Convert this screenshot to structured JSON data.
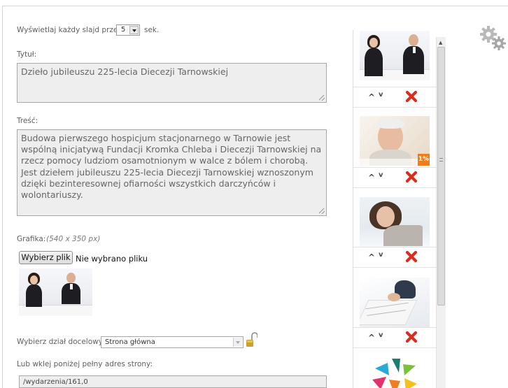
{
  "slide_duration": {
    "label": "Wyświetlaj każdy slajd przez:",
    "value": "5",
    "unit": "sek."
  },
  "title_field": {
    "label": "Tytuł:",
    "value": "Dzieło jubileuszu 225-lecia Diecezji Tarnowskiej"
  },
  "content_field": {
    "label": "Treść:",
    "value": "Budowa pierwszego hospicjum stacjonarnego w Tarnowie jest wspólną inicjatywą Fundacji Kromka Chleba i Diecezji Tarnowskiej na rzecz pomocy ludziom osamotnionym w walce z bólem i chorobą. Jest dziełem jubileuszu 225-lecia Diecezji Tarnowskiej wznoszonym dzięki bezinteresownej ofiarności wszystkich darczyńców i wolontariuszy."
  },
  "graphic": {
    "label": "Grafika:",
    "size_hint": "(540 x 350 px)",
    "choose_button": "Wybierz plik",
    "no_file_text": "Nie wybrano pliku"
  },
  "target_section": {
    "label": "Wybierz dział docelowy:",
    "selected": "Strona główna"
  },
  "url_field": {
    "label": "Lub wklej poniżej pełny adres strony:",
    "value": "/wydarzenia/161,0"
  },
  "slides": [
    {
      "icon": "officials-photo-thumbnail"
    },
    {
      "icon": "elderly-man-photo-thumbnail",
      "badge": "1%"
    },
    {
      "icon": "woman-portrait-thumbnail"
    },
    {
      "icon": "hands-documents-thumbnail"
    },
    {
      "icon": "colorful-logo-thumbnail"
    }
  ],
  "colors": {
    "delete_red": "#d92d1f",
    "badge_orange": "#f07d1a",
    "lock_gold": "#c9a227"
  }
}
